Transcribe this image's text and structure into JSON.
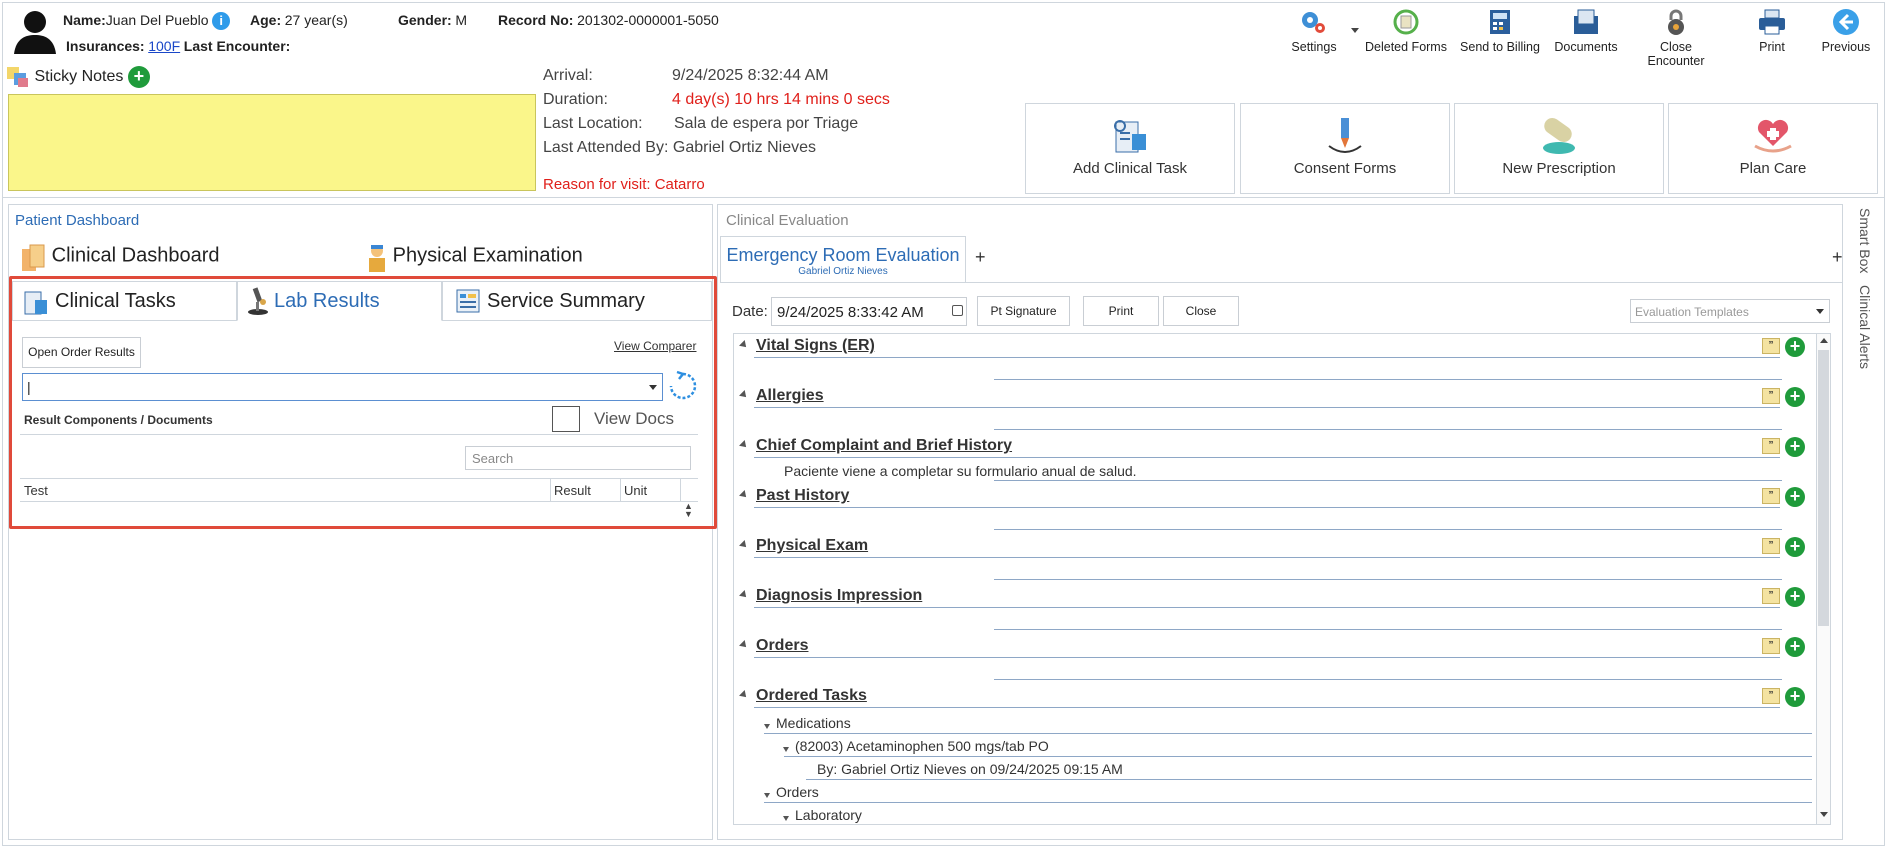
{
  "patient": {
    "name_label": "Name:",
    "name": "Juan Del Pueblo",
    "age_label": "Age:",
    "age": "27 year(s)",
    "gender_label": "Gender:",
    "gender": "M",
    "record_label": "Record No:",
    "record": "201302-0000001-5050",
    "insurances_label": "Insurances:",
    "insurance": "100F",
    "last_encounter_label": "Last Encounter:"
  },
  "toolbar": {
    "settings": "Settings",
    "deleted_forms": "Deleted Forms",
    "send_billing": "Send to Billing",
    "documents": "Documents",
    "close_encounter": "Close Encounter",
    "print": "Print",
    "previous": "Previous"
  },
  "sticky": {
    "label": "Sticky Notes"
  },
  "visit": {
    "arrival_label": "Arrival:",
    "arrival": "9/24/2025 8:32:44 AM",
    "duration_label": "Duration:",
    "duration": "4 day(s) 10 hrs 14 mins 0 secs",
    "last_location_label": "Last Location:",
    "last_location": "Sala de espera por Triage",
    "last_attended": "Last Attended By: Gabriel Ortiz Nieves",
    "reason": "Reason for visit: Catarro"
  },
  "actions": {
    "add_task": "Add Clinical Task",
    "consent": "Consent Forms",
    "prescription": "New Prescription",
    "plan_care": "Plan Care"
  },
  "dashboard": {
    "title": "Patient Dashboard",
    "clinical_dashboard": "Clinical Dashboard",
    "physical_exam": "Physical Examination",
    "tabs": [
      "Clinical Tasks",
      "Lab Results",
      "Service Summary"
    ],
    "open_order_results": "Open Order Results",
    "view_comparer": "View Comparer",
    "combo_value": "|",
    "result_components": "Result Components / Documents",
    "view_docs": "View Docs",
    "search_placeholder": "Search",
    "columns": [
      "Test",
      "Result",
      "Unit"
    ]
  },
  "evaluation": {
    "title": "Clinical Evaluation",
    "tab_title": "Emergency Room Evaluation",
    "tab_subtitle": "Gabriel Ortiz Nieves",
    "add_tab": "+",
    "date_label": "Date:",
    "date_value": "9/24/2025 8:33:42 AM",
    "pt_signature": "Pt Signature",
    "print": "Print",
    "close": "Close",
    "templates_placeholder": "Evaluation Templates",
    "sections": [
      "Vital Signs (ER)",
      "Allergies",
      "Chief Complaint and Brief History",
      "Past History",
      "Physical Exam",
      "Diagnosis Impression",
      "Orders",
      "Ordered Tasks"
    ],
    "chief_complaint_text": "Paciente viene a completar su formulario anual de salud.",
    "tree": {
      "medications": "Medications",
      "med_item": "(82003) Acetaminophen 500 mgs/tab PO",
      "med_by": "By: Gabriel Ortiz Nieves on 09/24/2025 09:15 AM",
      "orders": "Orders",
      "laboratory": "Laboratory"
    }
  },
  "side_tabs": {
    "smart_box": "Smart Box",
    "clinical_alerts": "Clinical Alerts"
  }
}
